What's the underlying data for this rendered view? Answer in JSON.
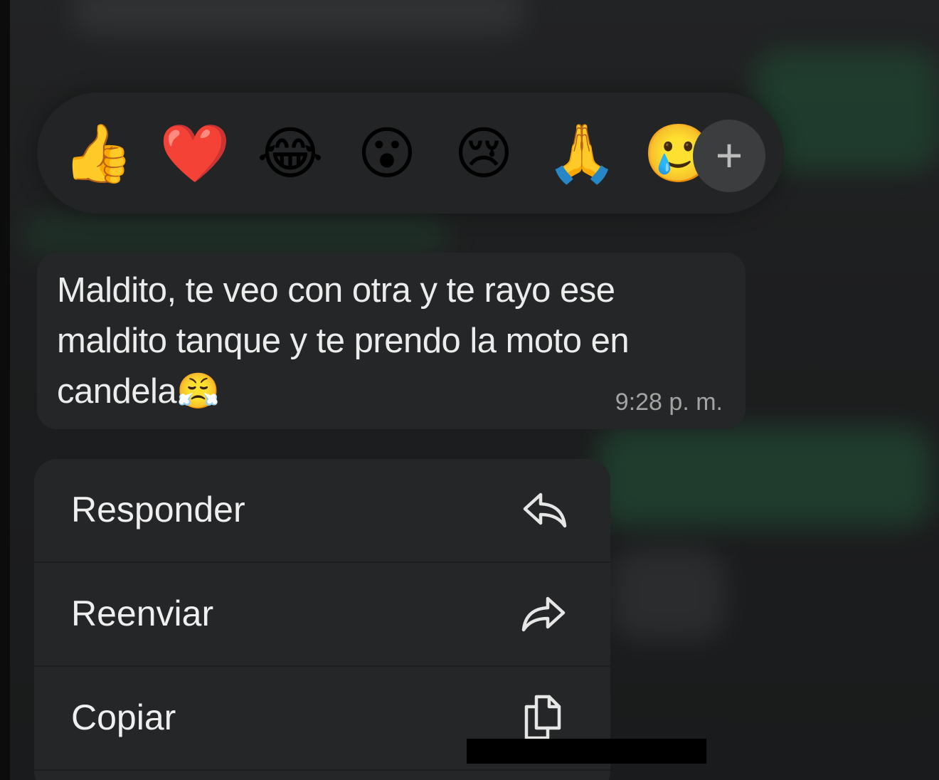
{
  "reactions": [
    {
      "emoji": "👍",
      "name": "thumbs-up"
    },
    {
      "emoji": "❤️",
      "name": "red-heart"
    },
    {
      "emoji": "😂",
      "name": "tears-of-joy"
    },
    {
      "emoji": "😮",
      "name": "open-mouth"
    },
    {
      "emoji": "😢",
      "name": "crying-face"
    },
    {
      "emoji": "🙏",
      "name": "folded-hands"
    },
    {
      "emoji": "🥲",
      "name": "smiling-tear"
    }
  ],
  "reaction_more": {
    "label": "+",
    "icon": "plus-icon"
  },
  "message": {
    "text": "Maldito, te veo con otra y te rayo ese maldito tanque y te prendo la moto en candela😤",
    "time": "9:28 p. m."
  },
  "menu": {
    "items": [
      {
        "label": "Responder",
        "icon": "reply-icon"
      },
      {
        "label": "Reenviar",
        "icon": "forward-icon"
      },
      {
        "label": "Copiar",
        "icon": "copy-icon"
      }
    ]
  },
  "colors": {
    "background": "#1b1c1d",
    "bubble": "#252627",
    "menu": "#252627",
    "text": "#ececec",
    "timestamp": "#a3a3a3"
  }
}
